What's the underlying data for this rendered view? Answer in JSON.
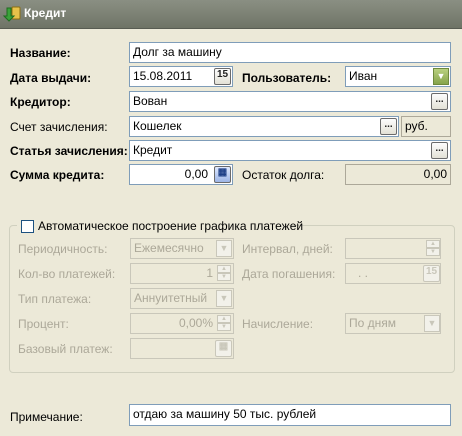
{
  "window": {
    "title": "Кредит"
  },
  "form": {
    "name_label": "Название:",
    "name_value": "Долг за машину",
    "date_label": "Дата выдачи:",
    "date_value": "15.08.2011",
    "user_label": "Пользователь:",
    "user_value": "Иван",
    "creditor_label": "Кредитор:",
    "creditor_value": "Вован",
    "account_label": "Счет зачисления:",
    "account_value": "Кошелек",
    "currency": "руб.",
    "article_label": "Статья зачисления:",
    "article_value": "Кредит",
    "amount_label": "Сумма кредита:",
    "amount_value": "0,00",
    "balance_label": "Остаток долга:",
    "balance_value": "0,00",
    "ellipsis": "...",
    "calc_symbol": "▦",
    "calendar_symbol": "15"
  },
  "schedule": {
    "auto_label": "Автоматическое построение графика платежей",
    "auto_checked": false,
    "period_label": "Периодичность:",
    "period_value": "Ежемесячно",
    "interval_label": "Интервал, дней:",
    "interval_value": "",
    "count_label": "Кол-во платежей:",
    "count_value": "1",
    "due_label": "Дата погашения:",
    "due_value": ". .",
    "type_label": "Тип платежа:",
    "type_value": "Аннуитетный",
    "percent_label": "Процент:",
    "percent_value": "0,00%",
    "accrual_label": "Начисление:",
    "accrual_value": "По дням",
    "base_label": "Базовый платеж:",
    "base_value": ""
  },
  "note": {
    "label": "Примечание:",
    "value": "отдаю за машину 50 тыс. рублей"
  },
  "colors": {
    "titlebar": "#7d8274",
    "window_bg": "#ece9d8",
    "field_border": "#7f9db9",
    "combo_green": "#86a44a"
  }
}
